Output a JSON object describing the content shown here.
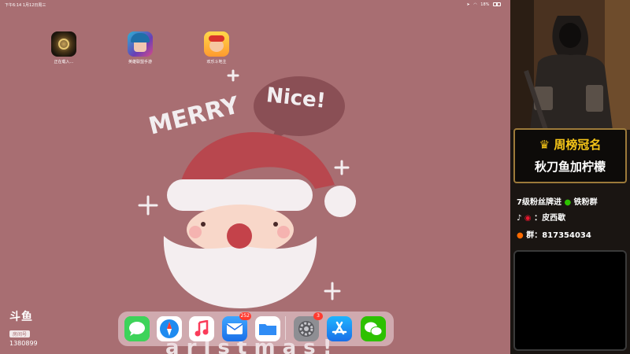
{
  "statusbar": {
    "time": "下午6:14",
    "date": "1月12日周三",
    "battery": "18%"
  },
  "home_apps": [
    {
      "label": "正在载入…",
      "icon": "game-icon"
    },
    {
      "label": "英雄联盟手游",
      "icon": "lol-icon"
    },
    {
      "label": "欢乐斗地主",
      "icon": "doudizhu-icon"
    }
  ],
  "wallpaper": {
    "merry": "MERRY",
    "nice": "Nice!"
  },
  "dock": {
    "mail_badge": "252",
    "settings_badge": "3"
  },
  "watermark": {
    "logo": "斗鱼",
    "sub": "房间号",
    "room_id": "1380899"
  },
  "overlay": {
    "rank_title": "周榜冠名",
    "rank_name": "秋刀鱼加柠檬",
    "line1": "7级粉丝牌进",
    "line1_tail": "铁粉群",
    "line2": "：皮西歇",
    "line3": "群：817354034"
  },
  "colors": {
    "wallpaper": "#a86e72",
    "rank_gold": "#f5c518"
  }
}
